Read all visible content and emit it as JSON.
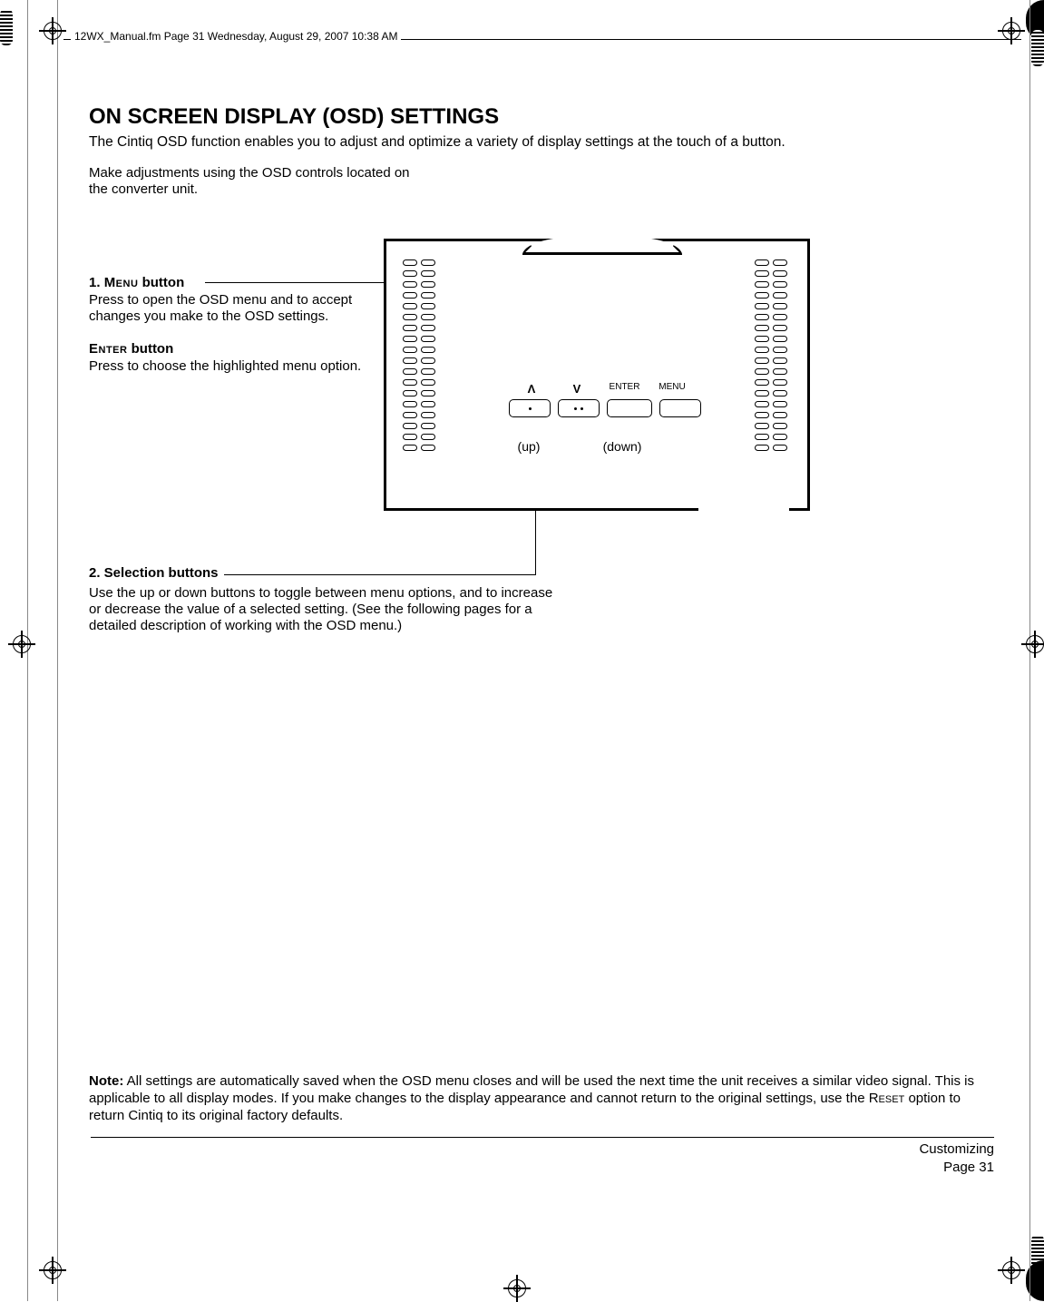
{
  "header": "12WX_Manual.fm  Page 31  Wednesday, August 29, 2007  10:38 AM",
  "title": "ON SCREEN DISPLAY (OSD) SETTINGS",
  "intro": "The Cintiq OSD function enables you to adjust and optimize a variety of display settings at the touch of a button.",
  "sub": "Make adjustments using the OSD controls located on the converter unit.",
  "callout1": {
    "num": "1.  ",
    "label": "Menu",
    "suffix": " button",
    "body": "Press to open the OSD menu and to accept changes you make to the OSD settings."
  },
  "callout_enter": {
    "label": "Enter",
    "suffix": " button",
    "body": "Press to choose the highlighted menu option."
  },
  "device": {
    "labels": {
      "up_sym": "Λ",
      "down_sym": "V",
      "enter": "ENTER",
      "menu": "MENU"
    },
    "sub_up": "(up)",
    "sub_down": "(down)"
  },
  "callout2": {
    "title": "2.  Selection buttons",
    "body": "Use the up or down buttons to toggle between menu options, and to increase or decrease the value of a selected setting.  (See the following pages for a detailed description of working with the OSD menu.)"
  },
  "note_label": "Note:",
  "note_body_a": " All settings are automatically saved when the OSD menu closes and will be used the next time the unit receives a similar video signal.  This is applicable to all display modes.  If you make changes to the display appearance and cannot return to the original settings, use the R",
  "note_reset": "eset",
  "note_body_b": " option to return Cintiq to its original factory defaults.",
  "footer": {
    "section": "Customizing",
    "page": "Page  31"
  }
}
